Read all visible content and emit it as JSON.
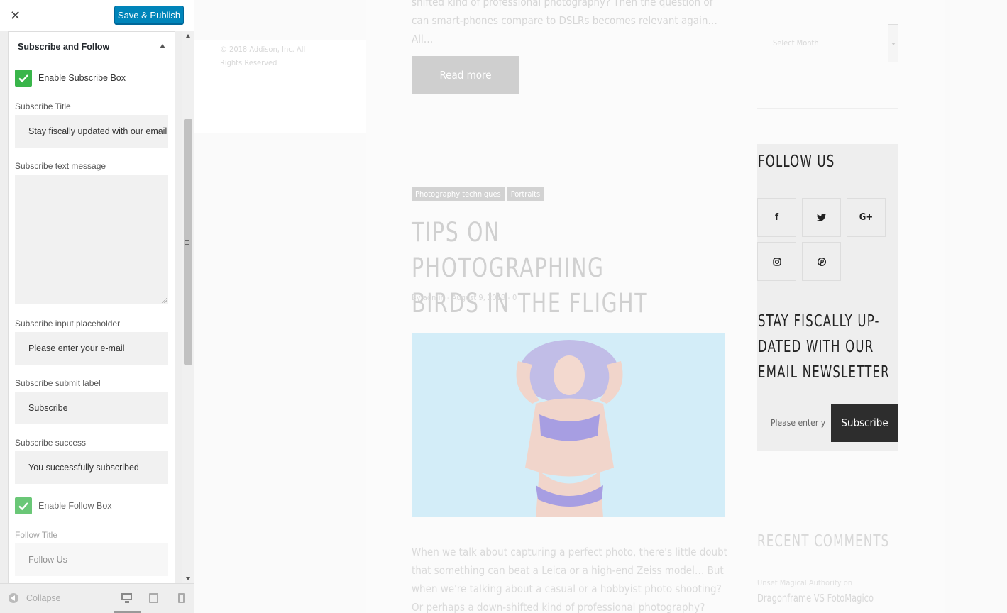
{
  "customizer": {
    "close_icon": "✕",
    "save_label": "Save & Publish",
    "section_title": "Subscribe and Follow",
    "enable_subscribe_label": "Enable Subscribe Box",
    "fields": {
      "subscribe_title": {
        "label": "Subscribe Title",
        "value": "Stay fiscally updated with our email newsletter"
      },
      "subscribe_text": {
        "label": "Subscribe text message",
        "value": ""
      },
      "subscribe_placeholder": {
        "label": "Subscribe input placeholder",
        "value": "Please enter your e-mail"
      },
      "subscribe_submit": {
        "label": "Subscribe submit label",
        "value": "Subscribe"
      },
      "subscribe_success": {
        "label": "Subscribe success",
        "value": "You successfully subscribed"
      },
      "follow_title": {
        "label": "Follow Title",
        "value": "Follow Us"
      }
    },
    "enable_follow_label": "Enable Follow Box",
    "footer": {
      "collapse_label": "Collapse"
    },
    "colors": {
      "accent": "#0085ba",
      "checkbox": "#39b54a"
    }
  },
  "preview": {
    "copyright": "© 2018 Addison, Inc. All Rights Reserved",
    "excerpt_top": "shifted kind of professional photography? Then the question of can smart-phones compare to DSLRs becomes relevant again… All…",
    "read_more": "Read more",
    "archive_select_placeholder": "Select Month",
    "tags": [
      "Photography techniques",
      "Portraits"
    ],
    "post_title": "Tips on photographing birds in the flight",
    "post_meta": "By admin - August 9, 2018 - 0",
    "excerpt_bottom": "When we talk about capturing a perfect photo, there's little doubt that something can beat a Leica or a high-end Zeiss model… But when we're talking about a casual or a hobbyist photo shooting? Or perhaps a down-shifted kind of professional photography? Then the question of can smart…",
    "follow_widget": {
      "title": "Follow Us",
      "social_icons": [
        "facebook-icon",
        "twitter-icon",
        "google-plus-icon",
        "instagram-icon",
        "pinterest-icon"
      ],
      "social_glyphs": [
        "f",
        "🐦",
        "G+",
        "◎",
        "℗"
      ]
    },
    "subscribe_widget": {
      "title": "Stay fiscally up-dated with our email newsletter",
      "input_placeholder": "Please enter y",
      "button_label": "Subscribe"
    },
    "recent_comments": {
      "title": "Recent Comments",
      "meta": "Unset Magical Authority on",
      "link": "Dragonframe VS FotoMagico"
    }
  }
}
